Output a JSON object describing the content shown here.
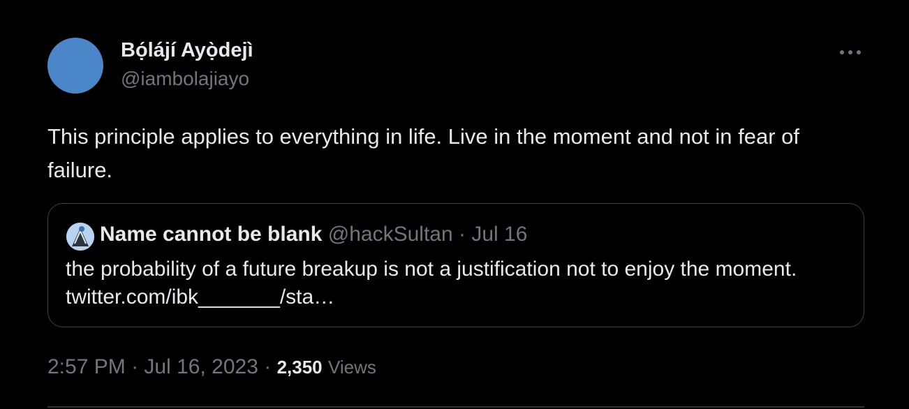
{
  "author": {
    "display_name": "Bọ́lájí Ayọ̀dejì",
    "handle": "@iambolajiayo",
    "avatar_color": "#4a86c8"
  },
  "tweet": {
    "text": "This principle applies to everything in life. Live in the moment and not in fear of failure."
  },
  "quote": {
    "display_name": "Name cannot be blank",
    "handle": "@hackSultan",
    "separator": "·",
    "date": "Jul 16",
    "text": "the probability of a future breakup is not a justification not to enjoy the moment. twitter.com/ibk_______/sta…"
  },
  "meta": {
    "time": "2:57 PM",
    "separator": "·",
    "date": "Jul 16, 2023",
    "views_count": "2,350",
    "views_label": "Views"
  },
  "icons": {
    "more": "more-horizontal-icon"
  },
  "colors": {
    "background": "#000000",
    "primary_text": "#e7e9ea",
    "secondary_text": "#71767b",
    "border": "#3e4144"
  }
}
